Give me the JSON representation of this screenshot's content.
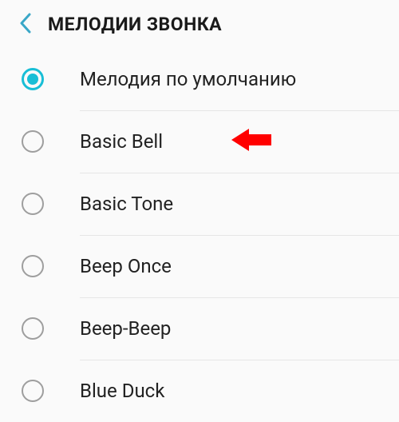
{
  "header": {
    "title": "МЕЛОДИИ ЗВОНКА"
  },
  "accent_color": "#18bed6",
  "ringtones": {
    "items": [
      {
        "label": "Мелодия по умолчанию",
        "selected": true,
        "highlight": false
      },
      {
        "label": "Basic Bell",
        "selected": false,
        "highlight": true
      },
      {
        "label": "Basic Tone",
        "selected": false,
        "highlight": false
      },
      {
        "label": "Beep Once",
        "selected": false,
        "highlight": false
      },
      {
        "label": "Beep-Beep",
        "selected": false,
        "highlight": false
      },
      {
        "label": "Blue Duck",
        "selected": false,
        "highlight": false
      }
    ]
  }
}
